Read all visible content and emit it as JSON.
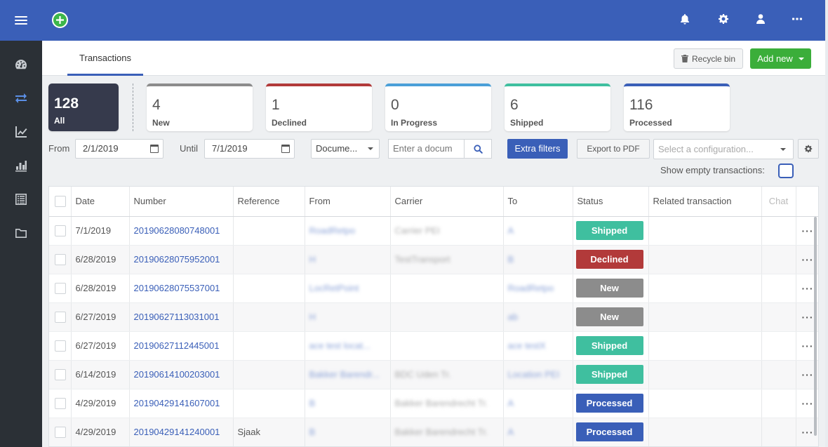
{
  "sidebar": {
    "items": [
      {
        "name": "dashboard-icon",
        "active": false
      },
      {
        "name": "transactions-icon",
        "active": true
      },
      {
        "name": "analytics-icon",
        "active": false
      },
      {
        "name": "reports-icon",
        "active": false
      },
      {
        "name": "list-icon",
        "active": false
      },
      {
        "name": "folder-icon",
        "active": false
      }
    ]
  },
  "header": {
    "tab_label": "Transactions",
    "recycle_bin_label": "Recycle bin",
    "add_new_label": "Add new"
  },
  "summary_cards": [
    {
      "count": "128",
      "label": "All",
      "color": "#363a4c"
    },
    {
      "count": "4",
      "label": "New",
      "color": "#8c8c8c"
    },
    {
      "count": "1",
      "label": "Declined",
      "color": "#b23a3a"
    },
    {
      "count": "0",
      "label": "In Progress",
      "color": "#4a9fd8"
    },
    {
      "count": "6",
      "label": "Shipped",
      "color": "#3fbf9f"
    },
    {
      "count": "116",
      "label": "Processed",
      "color": "#3a5fb8"
    }
  ],
  "filters": {
    "from_label": "From",
    "from_value": "2/1/2019",
    "until_label": "Until",
    "until_value": "7/1/2019",
    "document_select": "Docume...",
    "search_placeholder": "Enter a docum",
    "extra_filters_label": "Extra filters",
    "export_pdf_label": "Export to PDF",
    "configuration_placeholder": "Select a configuration...",
    "show_empty_label": "Show empty transactions:"
  },
  "table": {
    "columns": [
      "Date",
      "Number",
      "Reference",
      "From",
      "Carrier",
      "To",
      "Status",
      "Related transaction",
      "Chat"
    ],
    "rows": [
      {
        "date": "7/1/2019",
        "number": "20190628080748001",
        "reference": "",
        "from": "RoadRetpo",
        "carrier": "Carrier PEI",
        "to": "A",
        "status": "Shipped"
      },
      {
        "date": "6/28/2019",
        "number": "20190628075952001",
        "reference": "",
        "from": "H",
        "carrier": "TestTransport",
        "to": "B",
        "status": "Declined"
      },
      {
        "date": "6/28/2019",
        "number": "20190628075537001",
        "reference": "",
        "from": "LocRetPoint",
        "carrier": "",
        "to": "RoadRetpo",
        "status": "New"
      },
      {
        "date": "6/27/2019",
        "number": "20190627113031001",
        "reference": "",
        "from": "H",
        "carrier": "",
        "to": "ab",
        "status": "New"
      },
      {
        "date": "6/27/2019",
        "number": "20190627112445001",
        "reference": "",
        "from": "ace test locat...",
        "carrier": "",
        "to": "ace testX",
        "status": "Shipped"
      },
      {
        "date": "6/14/2019",
        "number": "20190614100203001",
        "reference": "",
        "from": "Bakker Barendr...",
        "carrier": "BDC Uden Tr.",
        "to": "Location PEI",
        "status": "Shipped"
      },
      {
        "date": "4/29/2019",
        "number": "20190429141607001",
        "reference": "",
        "from": "B",
        "carrier": "Bakker Barendrecht Tr.",
        "to": "A",
        "status": "Processed"
      },
      {
        "date": "4/29/2019",
        "number": "20190429141240001",
        "reference": "Sjaak",
        "from": "B",
        "carrier": "Bakker Barendrecht Tr.",
        "to": "A",
        "status": "Processed"
      }
    ]
  },
  "status_colors": {
    "Shipped": "#3fbf9f",
    "Declined": "#b23a3a",
    "New": "#8c8c8c",
    "Processed": "#3a5fb8"
  }
}
